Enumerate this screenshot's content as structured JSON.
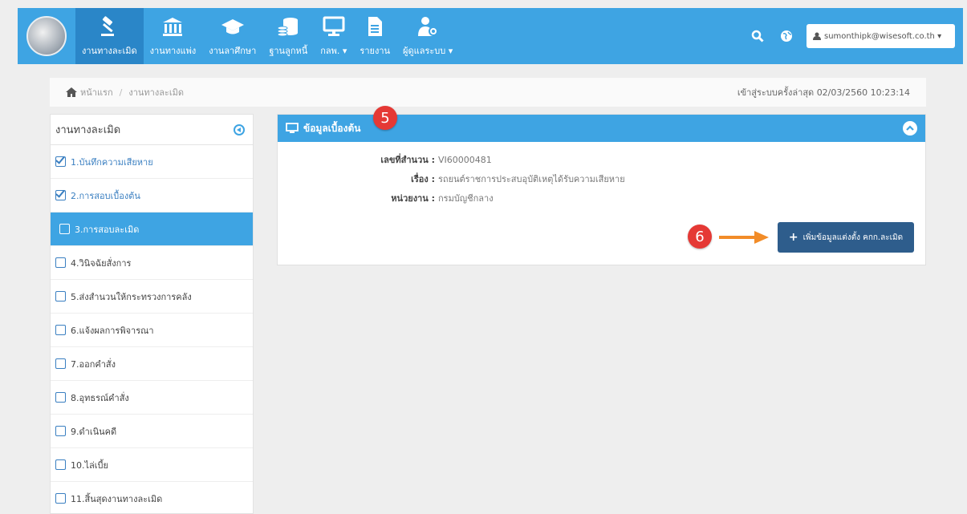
{
  "nav": {
    "items": [
      {
        "label": "งานทางละเมิด",
        "icon": "gavel-icon",
        "active": true
      },
      {
        "label": "งานทางแพ่ง",
        "icon": "bank-icon",
        "active": false
      },
      {
        "label": "งานลาศึกษา",
        "icon": "graduation-cap-icon",
        "active": false
      },
      {
        "label": "ฐานลูกหนี้",
        "icon": "database-coins-icon",
        "active": false
      },
      {
        "label": "กลพ. ▾",
        "icon": "monitor-icon",
        "active": false
      },
      {
        "label": "รายงาน",
        "icon": "document-icon",
        "active": false
      },
      {
        "label": "ผู้ดูแลระบบ ▾",
        "icon": "user-gear-icon",
        "active": false
      }
    ],
    "user": "sumonthipk@wisesoft.co.th ▾"
  },
  "breadcrumb": {
    "home": "หน้าแรก",
    "current": "งานทางละเมิด",
    "last_login": "เข้าสู่ระบบครั้งล่าสุด 02/03/2560 10:23:14"
  },
  "sidebar": {
    "title": "งานทางละเมิด",
    "items": [
      {
        "label": "1.บันทึกความเสียหาย",
        "state": "done"
      },
      {
        "label": "2.การสอบเบื้องต้น",
        "state": "done"
      },
      {
        "label": "3.การสอบละเมิด",
        "state": "active"
      },
      {
        "label": "4.วินิจฉัยสั่งการ",
        "state": "todo"
      },
      {
        "label": "5.ส่งสำนวนให้กระทรวงการคลัง",
        "state": "todo"
      },
      {
        "label": "6.แจ้งผลการพิจารณา",
        "state": "todo"
      },
      {
        "label": "7.ออกคำสั่ง",
        "state": "todo"
      },
      {
        "label": "8.อุทธรณ์คำสั่ง",
        "state": "todo"
      },
      {
        "label": "9.ดำเนินคดี",
        "state": "todo"
      },
      {
        "label": "10.ไล่เบี้ย",
        "state": "todo"
      },
      {
        "label": "11.สิ้นสุดงานทางละเมิด",
        "state": "todo"
      }
    ]
  },
  "panel": {
    "title": "ข้อมูลเบื้องต้น",
    "fields": [
      {
        "key": "เลขที่สำนวน :",
        "value": "VI60000481"
      },
      {
        "key": "เรื่อง :",
        "value": "รถยนต์ราชการประสบอุบัติเหตุได้รับความเสียหาย"
      },
      {
        "key": "หน่วยงาน :",
        "value": "กรมบัญชีกลาง"
      }
    ],
    "add_button": "เพิ่มข้อมูลแต่งตั้ง คกก.ละเมิด"
  },
  "annotations": {
    "step5": "5",
    "step6": "6"
  },
  "colors": {
    "primary": "#3ea4e3",
    "nav_active": "#2a86c8",
    "button": "#2e5d8c",
    "badge": "#e53935",
    "arrow": "#f28c28"
  }
}
